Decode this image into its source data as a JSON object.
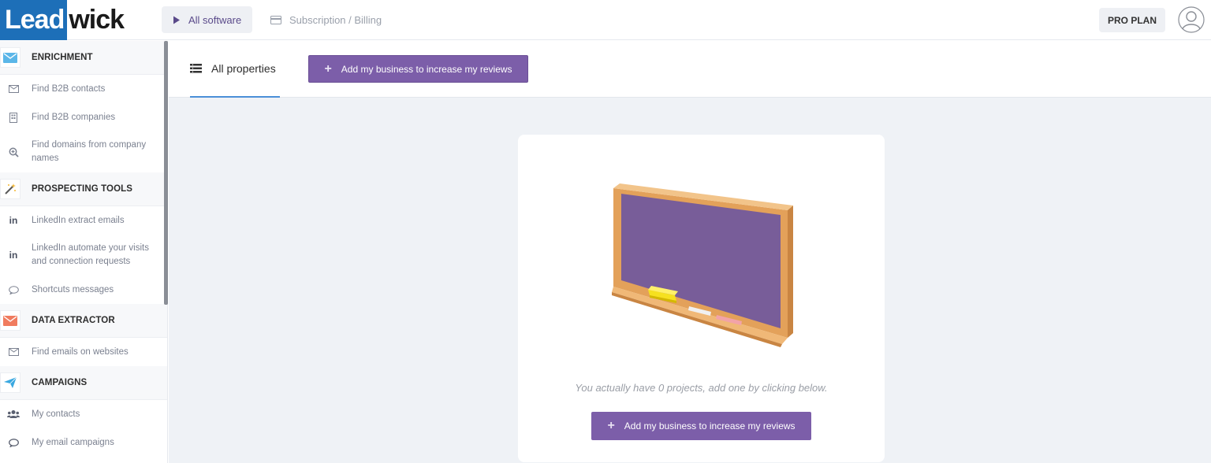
{
  "header": {
    "logo_part1": "Lead",
    "logo_part2": "wick",
    "tabs": [
      {
        "label": "All software",
        "icon": "play-icon",
        "active": true
      },
      {
        "label": "Subscription / Billing",
        "icon": "credit-card-icon",
        "active": false
      }
    ],
    "plan_label": "PRO PLAN",
    "avatar_icon": "user-avatar-icon"
  },
  "sidebar": {
    "sections": [
      {
        "title": "ENRICHMENT",
        "icon": "envelope-icon",
        "color": "#5bb6e8",
        "items": [
          {
            "label": "Find B2B contacts",
            "icon": "mail-outline-icon"
          },
          {
            "label": "Find B2B companies",
            "icon": "building-icon"
          },
          {
            "label": "Find domains from company names",
            "icon": "search-plus-icon"
          }
        ]
      },
      {
        "title": "PROSPECTING TOOLS",
        "icon": "magic-wand-icon",
        "color": "#f5b731",
        "items": [
          {
            "label": "LinkedIn extract emails",
            "icon": "linkedin-icon"
          },
          {
            "label": "LinkedIn automate your visits and connection requests",
            "icon": "linkedin-icon"
          },
          {
            "label": "Shortcuts messages",
            "icon": "chat-bubble-icon"
          }
        ]
      },
      {
        "title": "DATA EXTRACTOR",
        "icon": "envelope-icon",
        "color": "#f07b5e",
        "items": [
          {
            "label": "Find emails on websites",
            "icon": "mail-outline-icon"
          }
        ]
      },
      {
        "title": "CAMPAIGNS",
        "icon": "paper-plane-icon",
        "color": "#3aa8e0",
        "items": [
          {
            "label": "My contacts",
            "icon": "users-icon"
          },
          {
            "label": "My email campaigns",
            "icon": "chat-bubble-icon"
          }
        ]
      }
    ]
  },
  "main": {
    "tab_label": "All properties",
    "add_button_label": "Add my business to increase my reviews",
    "empty_message": "You actually have 0 projects, add one by clicking below.",
    "add_button_bottom_label": "Add my business to increase my reviews",
    "accent": "#7c5ea9"
  }
}
